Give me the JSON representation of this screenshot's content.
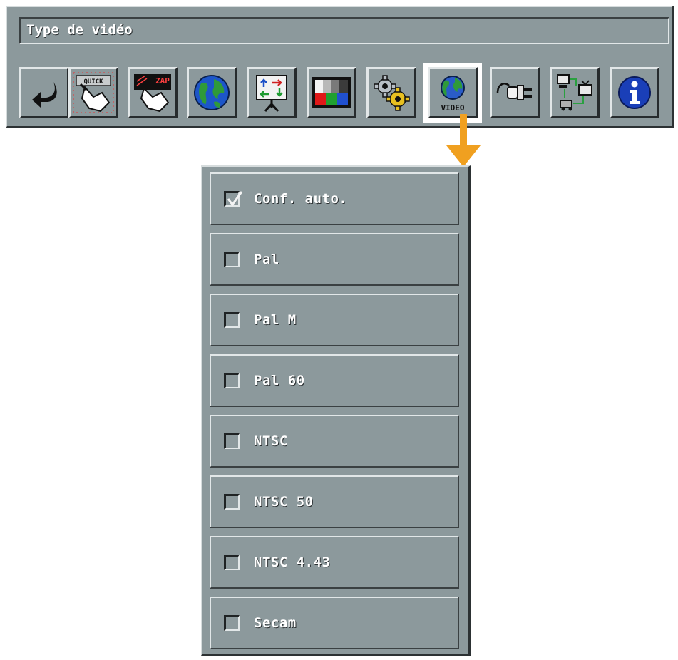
{
  "window": {
    "title": "Type de vidéo"
  },
  "toolbar": {
    "buttons": [
      {
        "icon": "back-arrow-icon"
      },
      {
        "icon": "quick-icon",
        "text": "QUICK"
      },
      {
        "icon": "zap-icon",
        "text": "ZAP"
      },
      {
        "icon": "globe-icon"
      },
      {
        "icon": "presentation-board-icon"
      },
      {
        "icon": "color-bars-icon"
      },
      {
        "icon": "gears-icon"
      },
      {
        "icon": "video-globe-icon",
        "text": "VIDEO",
        "selected": true
      },
      {
        "icon": "power-plug-icon"
      },
      {
        "icon": "network-tv-icon"
      },
      {
        "icon": "info-icon"
      }
    ]
  },
  "dropdown": {
    "options": [
      {
        "label": "Conf. auto.",
        "checked": true
      },
      {
        "label": "Pal",
        "checked": false
      },
      {
        "label": "Pal M",
        "checked": false
      },
      {
        "label": "Pal 60",
        "checked": false
      },
      {
        "label": "NTSC",
        "checked": false
      },
      {
        "label": "NTSC 50",
        "checked": false
      },
      {
        "label": "NTSC 4.43",
        "checked": false
      },
      {
        "label": "Secam",
        "checked": false
      }
    ]
  },
  "colors": {
    "panel": "#8c999c",
    "highlight": "#ffffff",
    "arrow": "#f0a020"
  }
}
